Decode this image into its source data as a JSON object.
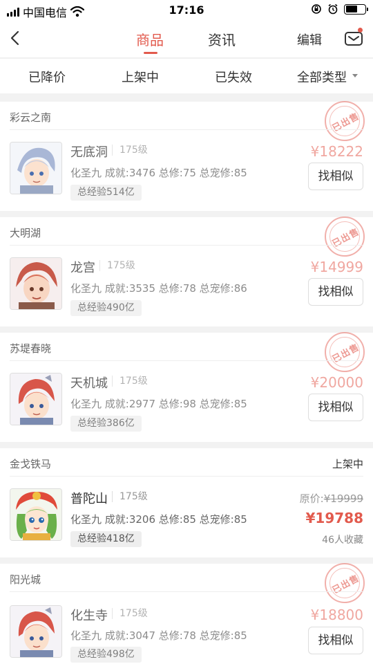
{
  "status_bar": {
    "carrier": "中国电信",
    "time": "17:16",
    "battery_fraction": 0.6
  },
  "nav": {
    "tabs": [
      {
        "label": "商品",
        "active": true
      },
      {
        "label": "资讯",
        "active": false
      }
    ],
    "edit_label": "编辑",
    "has_unread": true
  },
  "filters": [
    {
      "label": "已降价"
    },
    {
      "label": "上架中"
    },
    {
      "label": "已失效"
    },
    {
      "label": "全部类型"
    }
  ],
  "sold_stamp_label": "已出售",
  "similar_label": "找相似",
  "items": [
    {
      "server_region": "彩云之南",
      "school": "无底洞",
      "level": "175级",
      "stats": "化圣九 成就:3476 总修:75 总宠修:85",
      "exp": "总经验514亿",
      "price": "¥18222",
      "state": "sold"
    },
    {
      "server_region": "大明湖",
      "school": "龙宫",
      "level": "175级",
      "stats": "化圣九 成就:3535 总修:78 总宠修:86",
      "exp": "总经验490亿",
      "price": "¥14999",
      "state": "sold"
    },
    {
      "server_region": "苏堤春晓",
      "school": "天机城",
      "level": "175级",
      "stats": "化圣九 成就:2977 总修:98 总宠修:85",
      "exp": "总经验386亿",
      "price": "¥20000",
      "state": "sold"
    },
    {
      "server_region": "金戈铁马",
      "school": "普陀山",
      "level": "175级",
      "stats": "化圣九 成就:3206 总修:85 总宠修:85",
      "exp": "总经验418亿",
      "price": "¥19788",
      "state": "listed",
      "status_label": "上架中",
      "orig_price_label": "原价:",
      "orig_price_value": "¥19999",
      "favorites": "46人收藏"
    },
    {
      "server_region": "阳光城",
      "school": "化生寺",
      "level": "175级",
      "stats": "化圣九 成就:3047 总修:78 总宠修:85",
      "exp": "总经验498亿",
      "price": "¥18800",
      "state": "sold"
    }
  ],
  "colors": {
    "accent": "#e25a4d",
    "sold_price": "#f0a7a0",
    "background": "#f2f2f2"
  }
}
